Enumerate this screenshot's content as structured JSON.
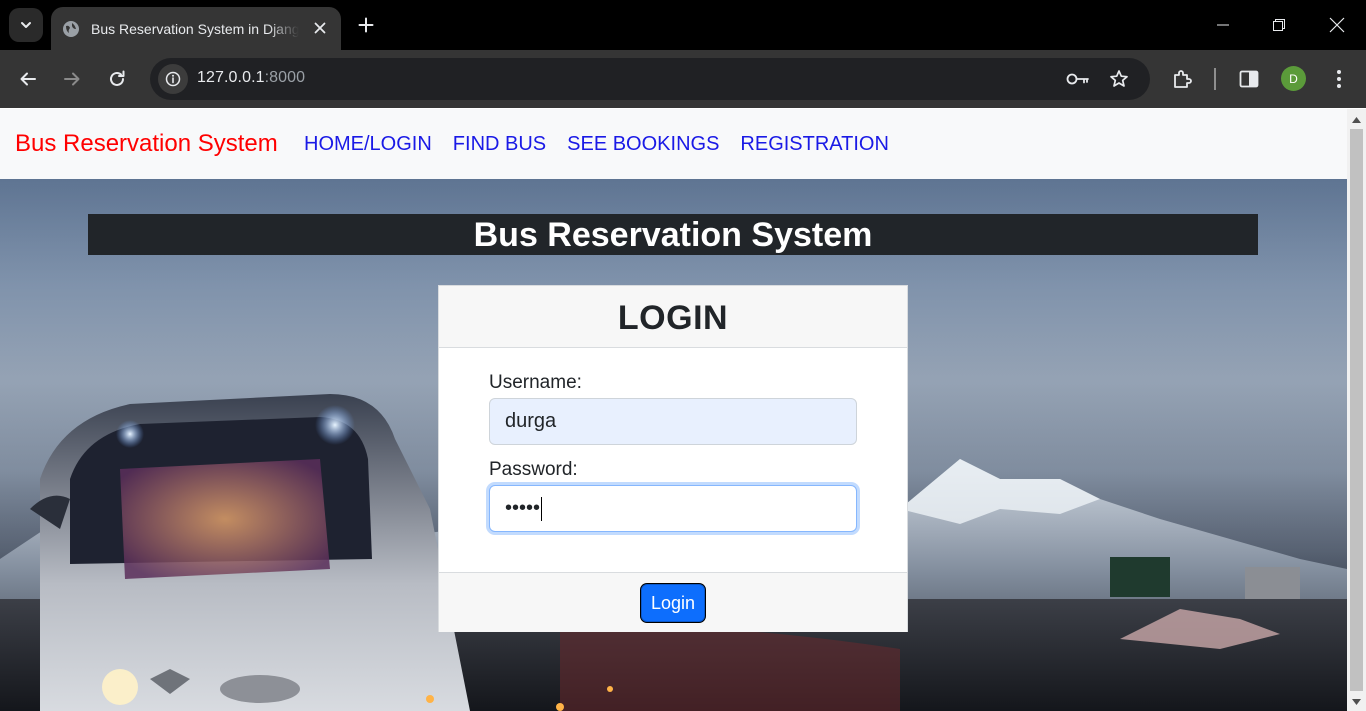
{
  "browser": {
    "tab_title": "Bus Reservation System in Django",
    "url_host": "127.0.0.1",
    "url_port": ":8000",
    "profile_initial": "D"
  },
  "page": {
    "brand": "Bus Reservation System",
    "nav": {
      "home": "HOME/LOGIN",
      "find": "FIND BUS",
      "bookings": "SEE BOOKINGS",
      "registration": "REGISTRATION"
    },
    "hero_title": "Bus Reservation System",
    "login": {
      "header": "LOGIN",
      "username_label": "Username:",
      "username_value": "durga",
      "password_label": "Password:",
      "password_masked": "•••••",
      "button": "Login"
    }
  },
  "colors": {
    "brand": "#ff0000",
    "nav_link": "#1a1ae6",
    "primary_button": "#0d6efd",
    "title_bar": "#212529"
  }
}
